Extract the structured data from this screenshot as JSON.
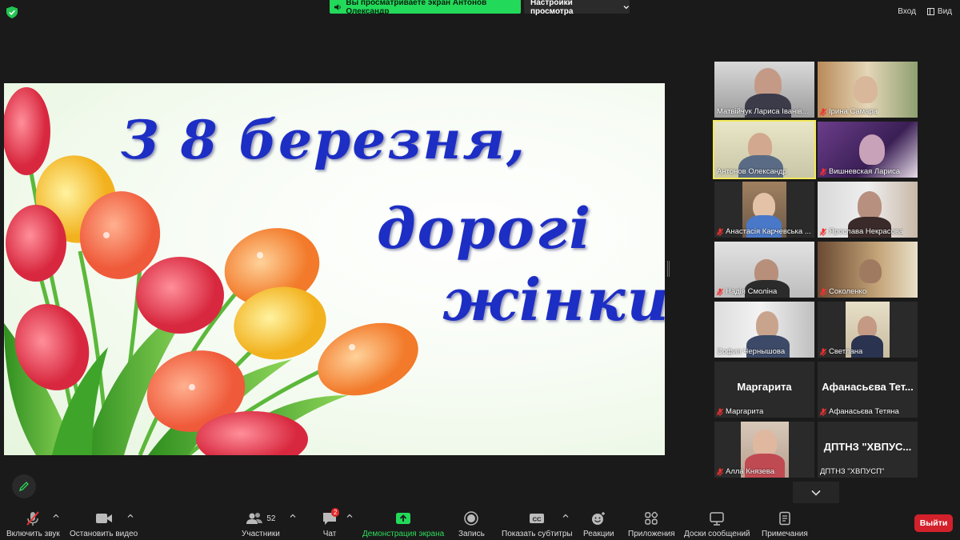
{
  "top": {
    "share_banner": "Вы просматриваете экран Антонов Олександр",
    "view_settings": "Настройки просмотра",
    "enter": "Вход",
    "view": "Вид"
  },
  "slide": {
    "line1": "З 8 березня,",
    "line2": "дорогі",
    "line3": "жінки!"
  },
  "participants": [
    {
      "name": "Матвійчук Лариса Іванів...",
      "muted": false,
      "video": true
    },
    {
      "name": "Ірина Самара",
      "muted": true,
      "video": true
    },
    {
      "name": "Антонов Олександр",
      "muted": false,
      "video": true,
      "active": true
    },
    {
      "name": "Вишневская Лариса",
      "muted": true,
      "video": true
    },
    {
      "name": "Анастасія Карчевська ...",
      "muted": true,
      "video": true
    },
    {
      "name": "Ярослава Некрасова",
      "muted": true,
      "video": true
    },
    {
      "name": "Надія Смоліна",
      "muted": true,
      "video": true
    },
    {
      "name": "Соколенко",
      "muted": true,
      "video": true
    },
    {
      "name": "София Чернышова",
      "muted": false,
      "video": true
    },
    {
      "name": "Светлана",
      "muted": true,
      "video": true
    },
    {
      "name": "Маргарита",
      "display": "Маргарита",
      "muted": true,
      "video": false
    },
    {
      "name": "Афанасьєва Тетяна",
      "display": "Афанасьєва Тет...",
      "muted": true,
      "video": false
    },
    {
      "name": "Алла Князева",
      "muted": true,
      "video": true
    },
    {
      "name": "ДПТНЗ \"ХВПУСП\"",
      "display": "ДПТНЗ \"ХВПУС...",
      "muted": false,
      "video": false
    }
  ],
  "toolbar": {
    "unmute": "Включить звук",
    "stop_video": "Остановить видео",
    "participants": "Участники",
    "participants_count": "52",
    "chat": "Чат",
    "chat_badge": "2",
    "share_screen": "Демонстрация экрана",
    "record": "Запись",
    "captions": "Показать субтитры",
    "reactions": "Реакции",
    "apps": "Приложения",
    "whiteboards": "Доски сообщений",
    "notes": "Примечания",
    "leave": "Выйти"
  },
  "colors": {
    "accent_green": "#23d959",
    "leave_red": "#d3212b",
    "active_speaker": "#f2e85b",
    "slide_text": "#1d2ec4"
  }
}
